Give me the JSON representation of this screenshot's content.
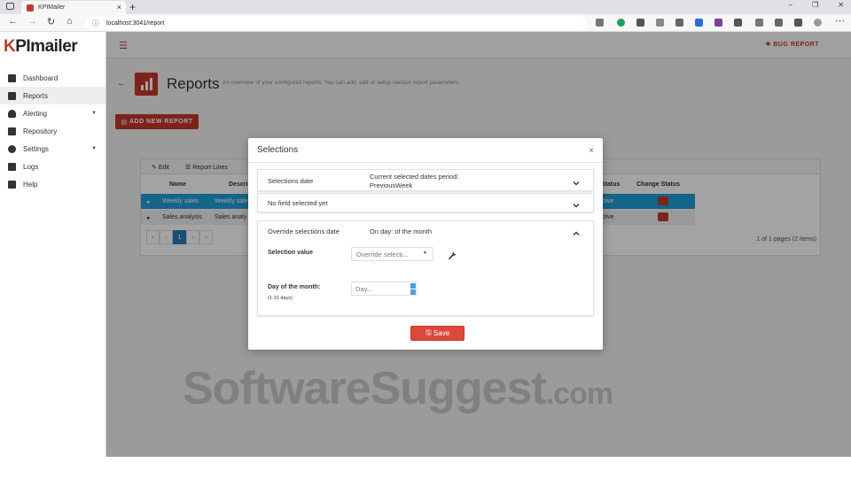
{
  "browser": {
    "tab_title": "KPIMailer",
    "url": "localhost:3041/report"
  },
  "sidebar": {
    "logo_mark": "K",
    "logo_text": "PImailer",
    "items": [
      {
        "label": "Dashboard",
        "icon": "dashboard-icon"
      },
      {
        "label": "Reports",
        "icon": "reports-icon"
      },
      {
        "label": "Alerting",
        "icon": "bell-icon"
      },
      {
        "label": "Repository",
        "icon": "folder-icon"
      },
      {
        "label": "Settings",
        "icon": "gear-icon"
      },
      {
        "label": "Logs",
        "icon": "logs-icon"
      },
      {
        "label": "Help",
        "icon": "help-icon"
      }
    ]
  },
  "header": {
    "bug_report": "BUG REPORT"
  },
  "page": {
    "title": "Reports",
    "subtitle": "An overview of your configured reports. You can add, edit or setup various report parameters.",
    "add_button": "ADD NEW REPORT"
  },
  "grid": {
    "toolbar": [
      "Edit",
      "Report Lines"
    ],
    "columns": [
      "Name",
      "Descri",
      "Status",
      "Change Status"
    ],
    "rows": [
      {
        "name": "Weekly sales",
        "desc": "Weekly sale",
        "status": "ctive"
      },
      {
        "name": "Sales analysis",
        "desc": "Sales analy",
        "status": "ctive"
      }
    ],
    "current_page": "1",
    "page_info": "1 of 1 pages (2 items)"
  },
  "modal": {
    "title": "Selections",
    "sections": [
      {
        "label": "Selections date",
        "value_line1": "Current selected dates period:",
        "value_line2": "PreviousWeek"
      },
      {
        "label": "No field selected yet"
      },
      {
        "label": "Override selections date",
        "value": "On day: of the month"
      }
    ],
    "selection_value_label": "Selection value",
    "selection_value_placeholder": "Override selecti...",
    "day_of_month_label": "Day of the month:",
    "day_of_month_hint": "(1-31 days)",
    "day_placeholder": "Day...",
    "save_label": "Save"
  },
  "watermark": {
    "text": "SoftwareSuggest",
    "suffix": ".com"
  },
  "colors": {
    "brand": "#c0392b",
    "selected_row": "#1e9fd6",
    "page_current": "#2a7ab8"
  }
}
